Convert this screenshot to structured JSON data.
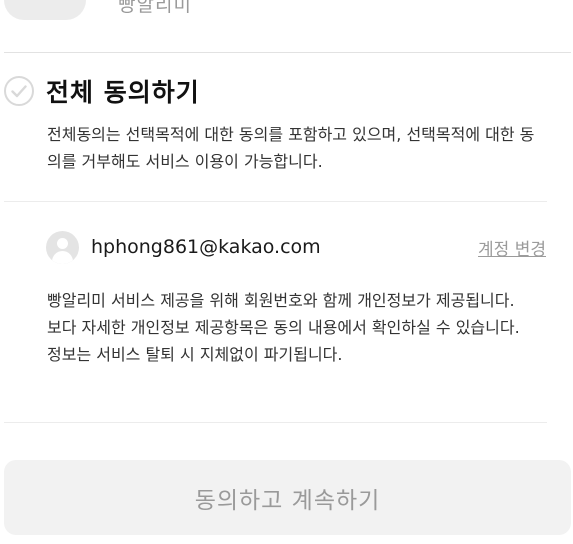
{
  "app": {
    "name": "빵알리미"
  },
  "agree_all": {
    "label": "전체 동의하기",
    "description": "전체동의는 선택목적에 대한 동의를 포함하고 있으며, 선택목적에 대한 동의를 거부해도 서비스 이용이 가능합니다."
  },
  "account": {
    "email": "hphong861@kakao.com",
    "change_label": "계정 변경"
  },
  "notice": {
    "text": "빵알리미 서비스 제공을 위해 회원번호와 함께 개인정보가 제공됩니다. 보다 자세한 개인정보 제공항목은 동의 내용에서 확인하실 수 있습니다. 정보는 서비스 탈퇴 시 지체없이 파기됩니다."
  },
  "continue_button": {
    "label": "동의하고 계속하기"
  },
  "colors": {
    "button_bg": "#f2f2f2",
    "button_text": "#9a9a9a",
    "check_border": "#d9d9d9",
    "link_gray": "#9b9b9b"
  }
}
